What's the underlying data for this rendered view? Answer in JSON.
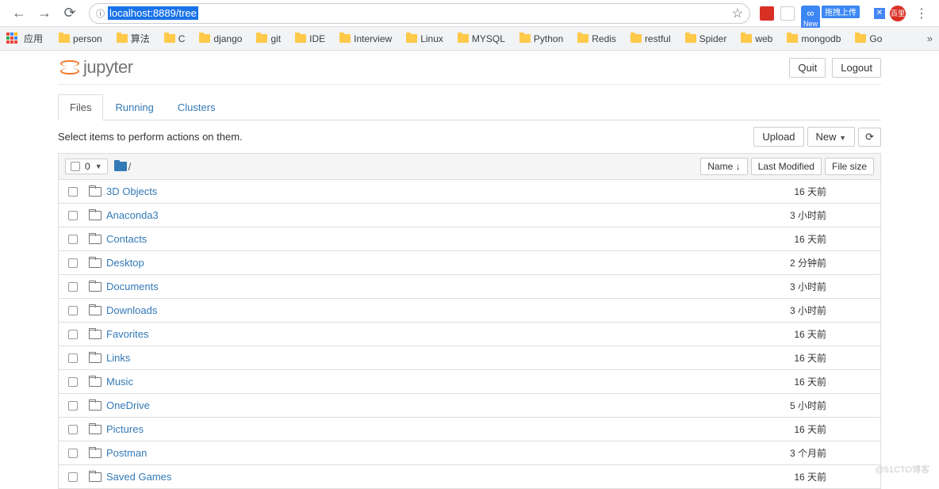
{
  "browser": {
    "url": "localhost:8889/tree",
    "apps_label": "应用",
    "bookmarks": [
      "person",
      "算法",
      "C",
      "django",
      "git",
      "IDE",
      "Interview",
      "Linux",
      "MYSQL",
      "Python",
      "Redis",
      "restful",
      "Spider",
      "web",
      "mongodb",
      "Go"
    ],
    "ext_upload": "拖拽上传",
    "ext_new": "New",
    "baidu": "百里"
  },
  "header": {
    "title": "jupyter",
    "quit": "Quit",
    "logout": "Logout"
  },
  "tabs": {
    "files": "Files",
    "running": "Running",
    "clusters": "Clusters"
  },
  "toolbar": {
    "hint": "Select items to perform actions on them.",
    "upload": "Upload",
    "new": "New",
    "refresh": "⟳"
  },
  "list_header": {
    "count": "0",
    "root": "/",
    "name": "Name",
    "last_modified": "Last Modified",
    "file_size": "File size"
  },
  "files": [
    {
      "name": "3D Objects",
      "modified": "16 天前"
    },
    {
      "name": "Anaconda3",
      "modified": "3 小时前"
    },
    {
      "name": "Contacts",
      "modified": "16 天前"
    },
    {
      "name": "Desktop",
      "modified": "2 分钟前"
    },
    {
      "name": "Documents",
      "modified": "3 小时前"
    },
    {
      "name": "Downloads",
      "modified": "3 小时前"
    },
    {
      "name": "Favorites",
      "modified": "16 天前"
    },
    {
      "name": "Links",
      "modified": "16 天前"
    },
    {
      "name": "Music",
      "modified": "16 天前"
    },
    {
      "name": "OneDrive",
      "modified": "5 小时前"
    },
    {
      "name": "Pictures",
      "modified": "16 天前"
    },
    {
      "name": "Postman",
      "modified": "3 个月前"
    },
    {
      "name": "Saved Games",
      "modified": "16 天前"
    }
  ],
  "watermark": "@51CTO博客"
}
